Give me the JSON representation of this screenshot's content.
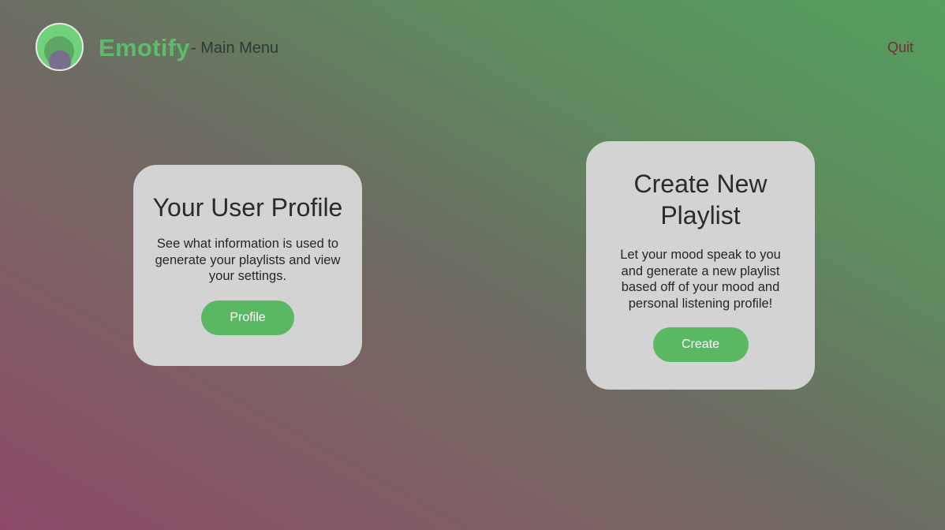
{
  "header": {
    "brand": "Emotify",
    "subtitle": "- Main Menu",
    "quit_label": "Quit"
  },
  "cards": {
    "profile": {
      "title": "Your User Profile",
      "description": "See what information is used to generate your playlists and view your settings.",
      "button_label": "Profile"
    },
    "create": {
      "title": "Create New Playlist",
      "description": "Let your mood speak to you and generate a new playlist based off of your mood and personal listening profile!",
      "button_label": "Create"
    }
  },
  "colors": {
    "brand": "#5bbd6a",
    "button": "#5ab862",
    "card": "#d3d3d3",
    "quit": "#7a2a3a"
  }
}
